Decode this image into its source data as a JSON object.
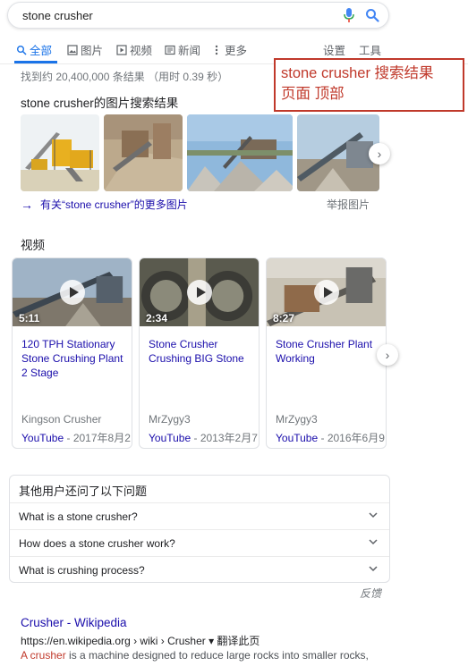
{
  "search": {
    "query": "stone crusher",
    "mic_icon": "mic-icon",
    "search_icon": "search-icon"
  },
  "tabs": {
    "all": "全部",
    "images": "图片",
    "videos": "视频",
    "news": "新闻",
    "more": "更多",
    "settings": "设置",
    "tools": "工具"
  },
  "stats": "找到约 20,400,000 条结果 （用时 0.39 秒）",
  "annotation": {
    "line1": "stone crusher 搜索结果",
    "line2": "页面 顶部"
  },
  "images": {
    "header": "stone crusher的图片搜索结果",
    "more_link": "有关“stone crusher”的更多图片",
    "report": "举报图片"
  },
  "videos": {
    "header": "视频",
    "items": [
      {
        "duration": "5:11",
        "title": "120 TPH Stationary Stone Crushing Plant 2 Stage",
        "channel": "Kingson Crusher",
        "source": "YouTube",
        "date": " - 2017年8月2"
      },
      {
        "duration": "2:34",
        "title": "Stone Crusher Crushing BIG Stone",
        "channel": "MrZygy3",
        "source": "YouTube",
        "date": " - 2013年2月7"
      },
      {
        "duration": "8:27",
        "title": "Stone Crusher Plant Working",
        "channel": "MrZygy3",
        "source": "YouTube",
        "date": " - 2016年6月9"
      }
    ]
  },
  "paa": {
    "title": "其他用户还问了以下问题",
    "questions": [
      "What is a stone crusher?",
      "How does a stone crusher work?",
      "What is crushing process?"
    ],
    "feedback": "反馈"
  },
  "result": {
    "title": "Crusher - Wikipedia",
    "url": "https://en.wikipedia.org › wiki › Crusher ▾ 翻译此页",
    "snippet_em": "A crusher",
    "snippet_rest": " is a machine designed to reduce large rocks into smaller rocks,"
  },
  "colors": {
    "link": "#1a0dab",
    "accent": "#1a73e8",
    "annotation": "#c0392b"
  }
}
